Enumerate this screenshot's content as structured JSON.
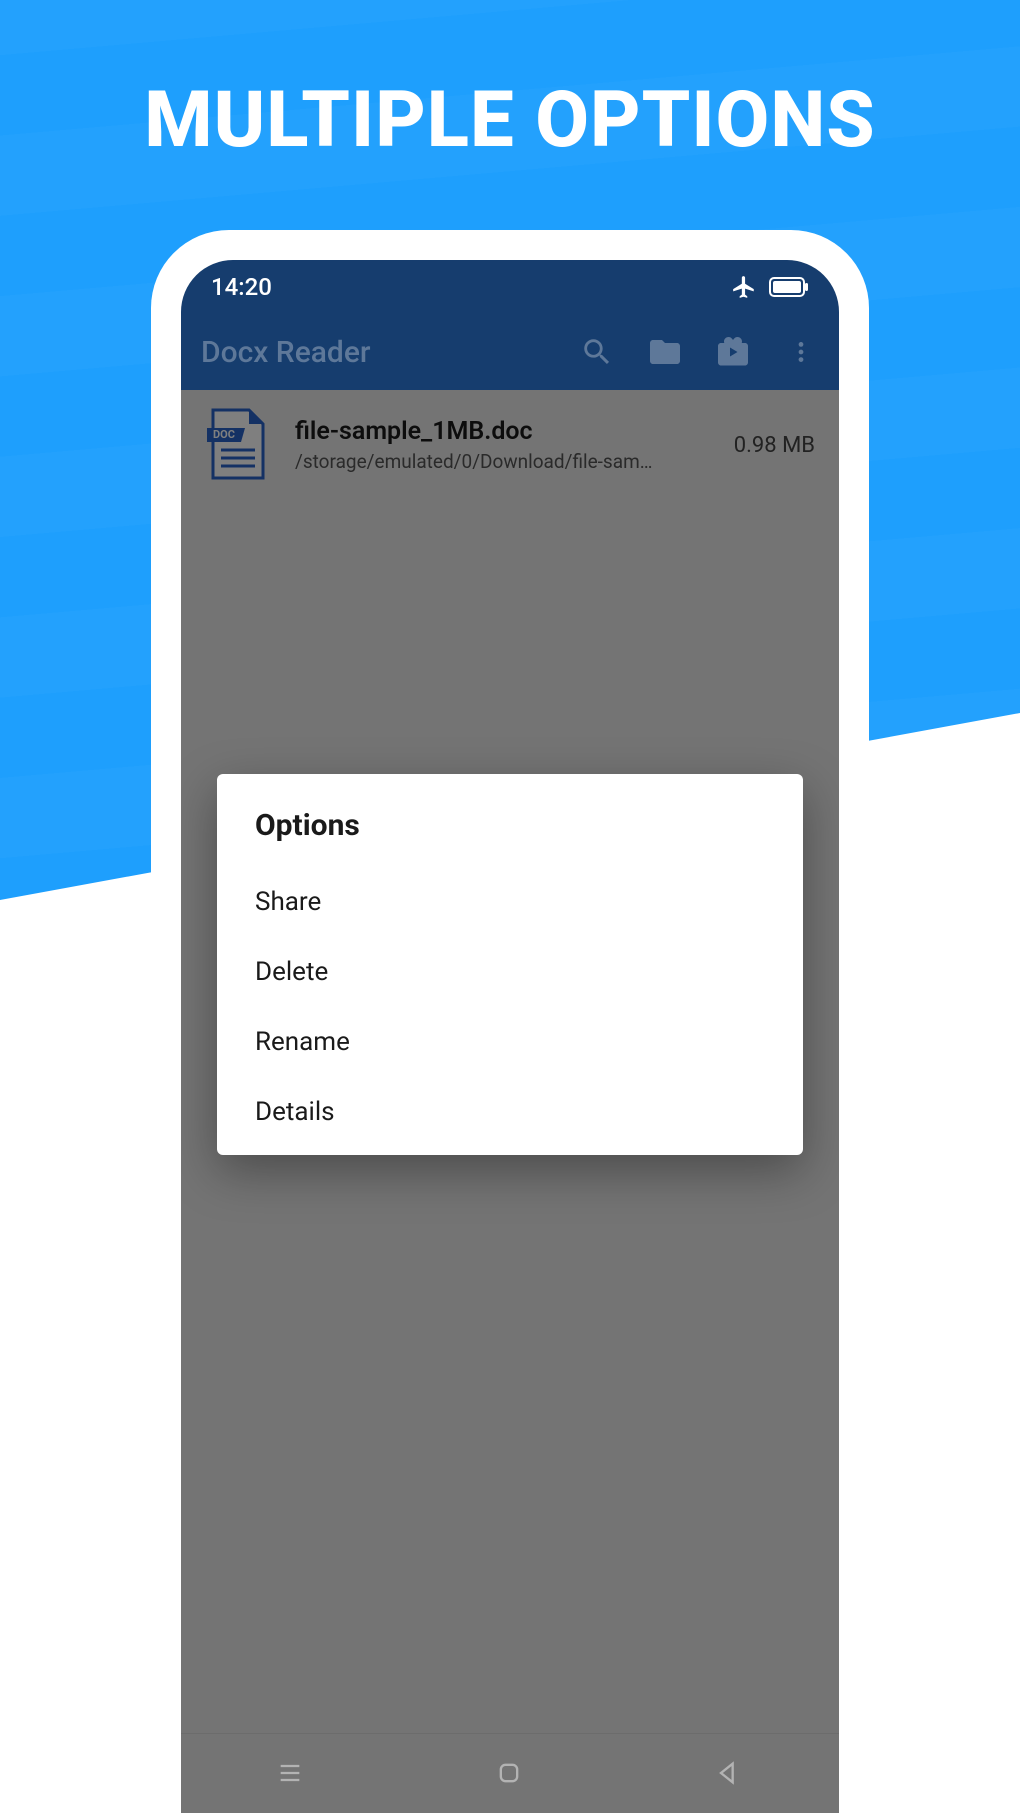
{
  "headline": "MULTIPLE OPTIONS",
  "status_bar": {
    "time": "14:20"
  },
  "app_bar": {
    "title": "Docx Reader"
  },
  "file": {
    "name": "file-sample_1MB.doc",
    "path": "/storage/emulated/0/Download/file-sam…",
    "size": "0.98 MB",
    "icon_label": "DOC"
  },
  "dialog": {
    "title": "Options",
    "items": {
      "share": "Share",
      "delete": "Delete",
      "rename": "Rename",
      "details": "Details"
    }
  }
}
